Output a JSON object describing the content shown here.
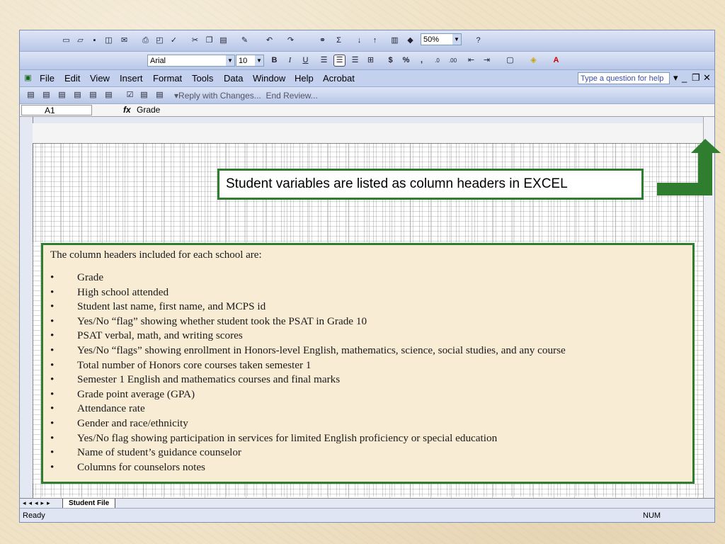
{
  "toolbar": {
    "zoom": "50%",
    "font_name": "Arial",
    "font_size": "10",
    "bold": "B",
    "italic": "I",
    "underline": "U",
    "currency": "$",
    "percent": "%",
    "comma": ","
  },
  "menu": {
    "items": [
      "File",
      "Edit",
      "View",
      "Insert",
      "Format",
      "Tools",
      "Data",
      "Window",
      "Help",
      "Acrobat"
    ],
    "help_placeholder": "Type a question for help"
  },
  "review_bar": {
    "reply": "Reply with Changes...",
    "end_review": "End Review..."
  },
  "formula_bar": {
    "cell_ref": "A1",
    "fx": "fx",
    "value": "Grade"
  },
  "sheet": {
    "tab": "Student File"
  },
  "status": {
    "ready": "Ready",
    "num": "NUM"
  },
  "callout": {
    "text": "Student variables are listed as column headers in EXCEL"
  },
  "list": {
    "intro": "The column headers included for each school are:",
    "items": [
      "Grade",
      "High school attended",
      "Student last name, first name, and MCPS id",
      "Yes/No “flag” showing whether student took the PSAT in Grade 10",
      "PSAT verbal, math, and writing scores",
      "Yes/No “flags” showing enrollment in Honors-level English, mathematics, science, social studies, and any course",
      "Total number of Honors core courses taken semester 1",
      "Semester 1 English and mathematics courses and final marks",
      "Grade point average (GPA)",
      "Attendance rate",
      "Gender and race/ethnicity",
      "Yes/No flag showing participation in services for  limited English proficiency or special education",
      "Name of student’s guidance counselor",
      "Columns for counselors notes"
    ]
  },
  "colors": {
    "accent_green": "#2f7d2f",
    "toolbar_blue": "#c4d1ee",
    "background": "#efe2c6"
  }
}
